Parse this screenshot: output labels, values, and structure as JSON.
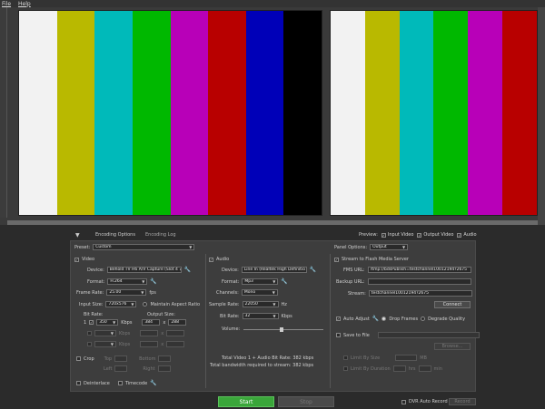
{
  "menu": {
    "file": "File",
    "help": "Help"
  },
  "colors": {
    "bars": [
      "#f2f2f2",
      "#b9b900",
      "#00baba",
      "#00b800",
      "#b800b8",
      "#b80000",
      "#0000b8",
      "#000000"
    ]
  },
  "tabs": {
    "encoding_options": "Encoding Options",
    "encoding_log": "Encoding Log"
  },
  "preview": {
    "label": "Preview:",
    "input_video": "Input Video",
    "output_video": "Output Video",
    "audio": "Audio"
  },
  "preset": {
    "label": "Preset:",
    "value": "Custom"
  },
  "panel_options": {
    "label": "Panel Options:",
    "value": "Output"
  },
  "video": {
    "title": "Video",
    "device_label": "Device:",
    "device_value": "Behold TV H6 A/V Capture (Slot 4",
    "format_label": "Format:",
    "format_value": "H.264",
    "frame_rate_label": "Frame Rate:",
    "frame_rate_value": "25.00",
    "fps": "fps",
    "input_size_label": "Input Size:",
    "input_size_value": "720x576",
    "maintain_aspect": "Maintain Aspect Ratio",
    "bitrate_header": "Bit Rate:",
    "output_size_header": "Output Size:",
    "rows": [
      {
        "num": "1",
        "bitrate": "350",
        "unit": "Kbps",
        "w": "384",
        "x": "x",
        "h": "288"
      },
      {
        "num": "",
        "bitrate": "",
        "unit": "Kbps",
        "w": "",
        "x": "x",
        "h": ""
      },
      {
        "num": "",
        "bitrate": "",
        "unit": "Kbps",
        "w": "",
        "x": "x",
        "h": ""
      }
    ],
    "crop": "Crop",
    "top": "Top",
    "bottom": "Bottom",
    "left": "Left",
    "right": "Right",
    "deinterlace": "Deinterlace",
    "timecode": "Timecode"
  },
  "audio": {
    "title": "Audio",
    "device_label": "Device:",
    "device_value": "Line In (Realtek High Definitio",
    "format_label": "Format:",
    "format_value": "Mp3",
    "channels_label": "Channels:",
    "channels_value": "Mono",
    "sample_rate_label": "Sample Rate:",
    "sample_rate_value": "22050",
    "hz": "Hz",
    "bit_rate_label": "Bit Rate:",
    "bit_rate_value": "32",
    "kbps": "Kbps",
    "volume_label": "Volume:",
    "volume_level": 0.45,
    "total_line1": "Total Video 1 + Audio Bit Rate:  382 kbps",
    "total_line2": "Total bandwidth required to stream:  382 kbps"
  },
  "fms": {
    "title": "Stream to Flash Media Server",
    "url_label": "FMS URL:",
    "url_value": "rtmp://bdsPublish=testchannel10012194?2675",
    "backup_label": "Backup URL:",
    "backup_value": "",
    "stream_label": "Stream:",
    "stream_value": "testchannel10012194?2675",
    "connect": "Connect",
    "auto_adjust": "Auto Adjust",
    "drop_frames": "Drop Frames",
    "degrade_quality": "Degrade Quality",
    "save_to_file": "Save to File",
    "browse": "Browse...",
    "limit_size": "Limit By Size",
    "mb": "MB",
    "limit_duration": "Limit By Duration",
    "hrs": "hrs",
    "min": "min"
  },
  "bottom": {
    "start": "Start",
    "stop": "Stop",
    "dvr_auto_record": "DVR Auto Record",
    "record": "Record"
  }
}
